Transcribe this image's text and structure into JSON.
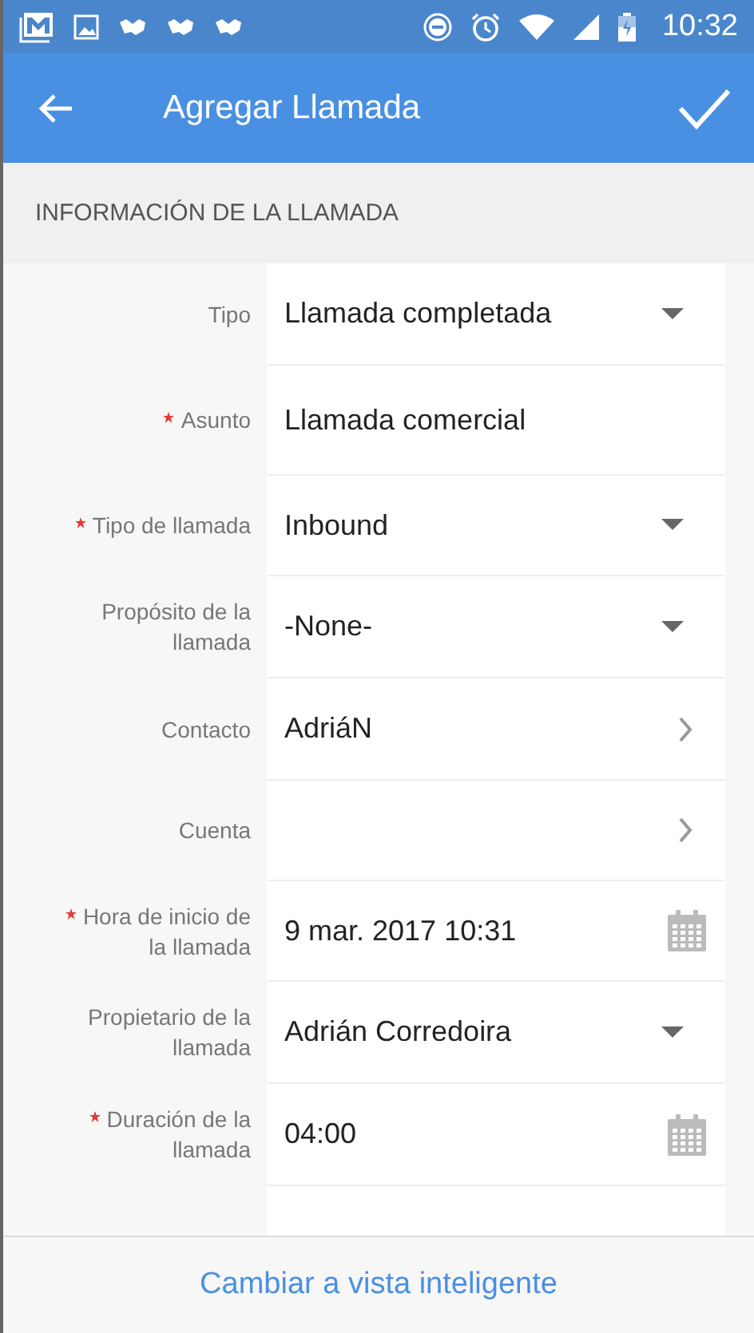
{
  "status_bar": {
    "time": "10:32"
  },
  "app_bar": {
    "title": "Agregar Llamada"
  },
  "section": {
    "title": "INFORMACIÓN DE LA LLAMADA"
  },
  "fields": [
    {
      "label": "Tipo",
      "required": false,
      "kind": "dropdown",
      "value": "Llamada completada"
    },
    {
      "label": "Asunto",
      "required": true,
      "kind": "text",
      "value": "Llamada comercial"
    },
    {
      "label": "Tipo de llamada",
      "required": true,
      "kind": "dropdown",
      "value": "Inbound"
    },
    {
      "label": "Propósito de la llamada",
      "required": false,
      "kind": "dropdown",
      "value": "-None-"
    },
    {
      "label": "Contacto",
      "required": false,
      "kind": "link",
      "value": "AdriáN"
    },
    {
      "label": "Cuenta",
      "required": false,
      "kind": "link"
    },
    {
      "label": "Hora de inicio de la llamada",
      "required": true,
      "kind": "date",
      "value": "9 mar. 2017 10:31"
    },
    {
      "label": "Propietario de la llamada",
      "required": false,
      "kind": "dropdown",
      "value": "Adrián Corredoira"
    },
    {
      "label": "Duración de la llamada",
      "required": true,
      "kind": "date",
      "value": "04:00"
    }
  ],
  "footer": {
    "link": "Cambiar a vista inteligente"
  }
}
